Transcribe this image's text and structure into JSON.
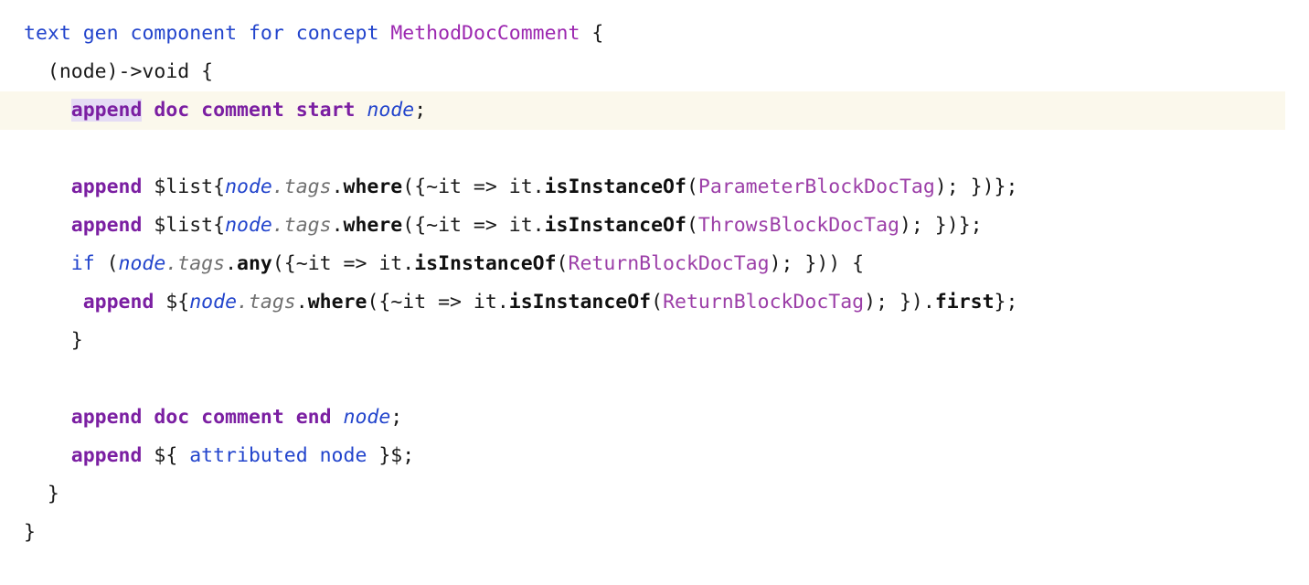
{
  "editor": {
    "language": "mps-textgen",
    "background_color": "#ffffff",
    "highlight_line_color": "#fbf8ec",
    "selection_color": "#e5dcf5",
    "colors": {
      "keyword": "#2244cc",
      "concept": "#9c27b0",
      "class_ref": "#9c3fa8",
      "command": "#7b1fa2",
      "variable": "#2244cc",
      "property": "#707070",
      "method": "#101010",
      "plain": "#1a1a1a"
    }
  },
  "code": {
    "line1": {
      "kw_text": "text",
      "kw_gen": "gen",
      "kw_component": "component",
      "kw_for": "for",
      "kw_concept": "concept",
      "concept_name": "MethodDocComment",
      "brace_open": "{"
    },
    "line2": {
      "signature": "(node)->void {"
    },
    "line3": {
      "append": "append",
      "cmd_rest": "doc comment start",
      "node": "node",
      "semi": ";"
    },
    "line4": {
      "blank": ""
    },
    "line5": {
      "append": "append",
      "list_open": "$list{",
      "node": "node",
      "tags": ".tags",
      "dot": ".",
      "where": "where",
      "lambda_open": "({~it => it",
      "dot2": ".",
      "is_instance_of": "isInstanceOf",
      "paren_open": "(",
      "class_ref": "ParameterBlockDocTag",
      "tail": "); })};"
    },
    "line6": {
      "append": "append",
      "list_open": "$list{",
      "node": "node",
      "tags": ".tags",
      "dot": ".",
      "where": "where",
      "lambda_open": "({~it => it",
      "dot2": ".",
      "is_instance_of": "isInstanceOf",
      "paren_open": "(",
      "class_ref": "ThrowsBlockDocTag",
      "tail": "); })};"
    },
    "line7": {
      "if_kw": "if",
      "paren_open": " (",
      "node": "node",
      "tags": ".tags",
      "dot": ".",
      "any": "any",
      "lambda_open": "({~it => it",
      "dot2": ".",
      "is_instance_of": "isInstanceOf",
      "paren2": "(",
      "class_ref": "ReturnBlockDocTag",
      "tail": "); })) {"
    },
    "line8": {
      "append": "append",
      "expr_open": "${",
      "node": "node",
      "tags": ".tags",
      "dot": ".",
      "where": "where",
      "lambda_open": "({~it => it",
      "dot2": ".",
      "is_instance_of": "isInstanceOf",
      "paren_open": "(",
      "class_ref": "ReturnBlockDocTag",
      "mid": "); }).",
      "first": "first",
      "tail": "};"
    },
    "line9": {
      "brace_close": "}"
    },
    "line10": {
      "blank": ""
    },
    "line11": {
      "append": "append",
      "cmd_rest": "doc comment end",
      "node": "node",
      "semi": ";"
    },
    "line12": {
      "append": "append",
      "expr_open": "${",
      "attributed_node": " attributed node ",
      "tail": "}$;"
    },
    "line13": {
      "brace_close": "}"
    },
    "line14": {
      "brace_close": "}"
    }
  }
}
